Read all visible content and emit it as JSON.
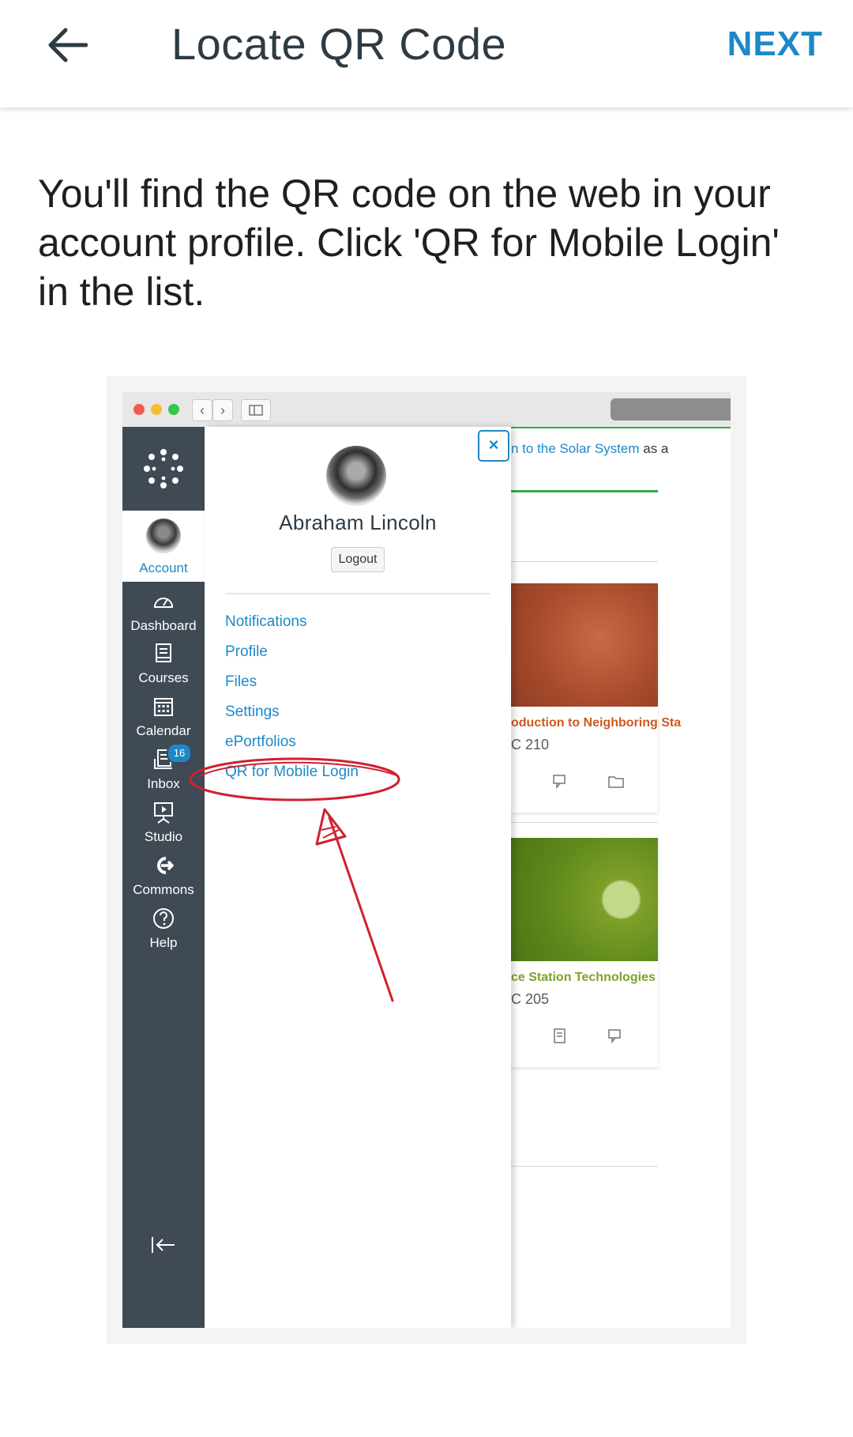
{
  "header": {
    "title": "Locate QR Code",
    "next_label": "NEXT"
  },
  "instruction": "You'll find the QR code on the web in your account profile. Click 'QR for Mobile Login' in the list.",
  "screenshot": {
    "sidebar": {
      "account_label": "Account",
      "items": [
        {
          "label": "Dashboard",
          "icon": "dashboard-icon"
        },
        {
          "label": "Courses",
          "icon": "courses-icon"
        },
        {
          "label": "Calendar",
          "icon": "calendar-icon"
        },
        {
          "label": "Inbox",
          "icon": "inbox-icon",
          "badge": "16"
        },
        {
          "label": "Studio",
          "icon": "studio-icon"
        },
        {
          "label": "Commons",
          "icon": "commons-icon"
        },
        {
          "label": "Help",
          "icon": "help-icon"
        }
      ]
    },
    "tray": {
      "close_symbol": "×",
      "user_name": "Abraham Lincoln",
      "logout_label": "Logout",
      "links": [
        "Notifications",
        "Profile",
        "Files",
        "Settings",
        "ePortfolios",
        "QR for Mobile Login"
      ]
    },
    "background": {
      "top_link": "n to the Solar System",
      "top_link_suffix": " as a",
      "courses": [
        {
          "title": "oduction to Neighboring Sta",
          "code": "C 210",
          "title_color": "#d2571f"
        },
        {
          "title": "ce Station Technologies",
          "code": "C 205",
          "title_color": "#7fa02a"
        }
      ]
    },
    "colors": {
      "link": "#1e88c7",
      "sidebar": "#3f4a55",
      "annotation": "#d0202e"
    }
  }
}
